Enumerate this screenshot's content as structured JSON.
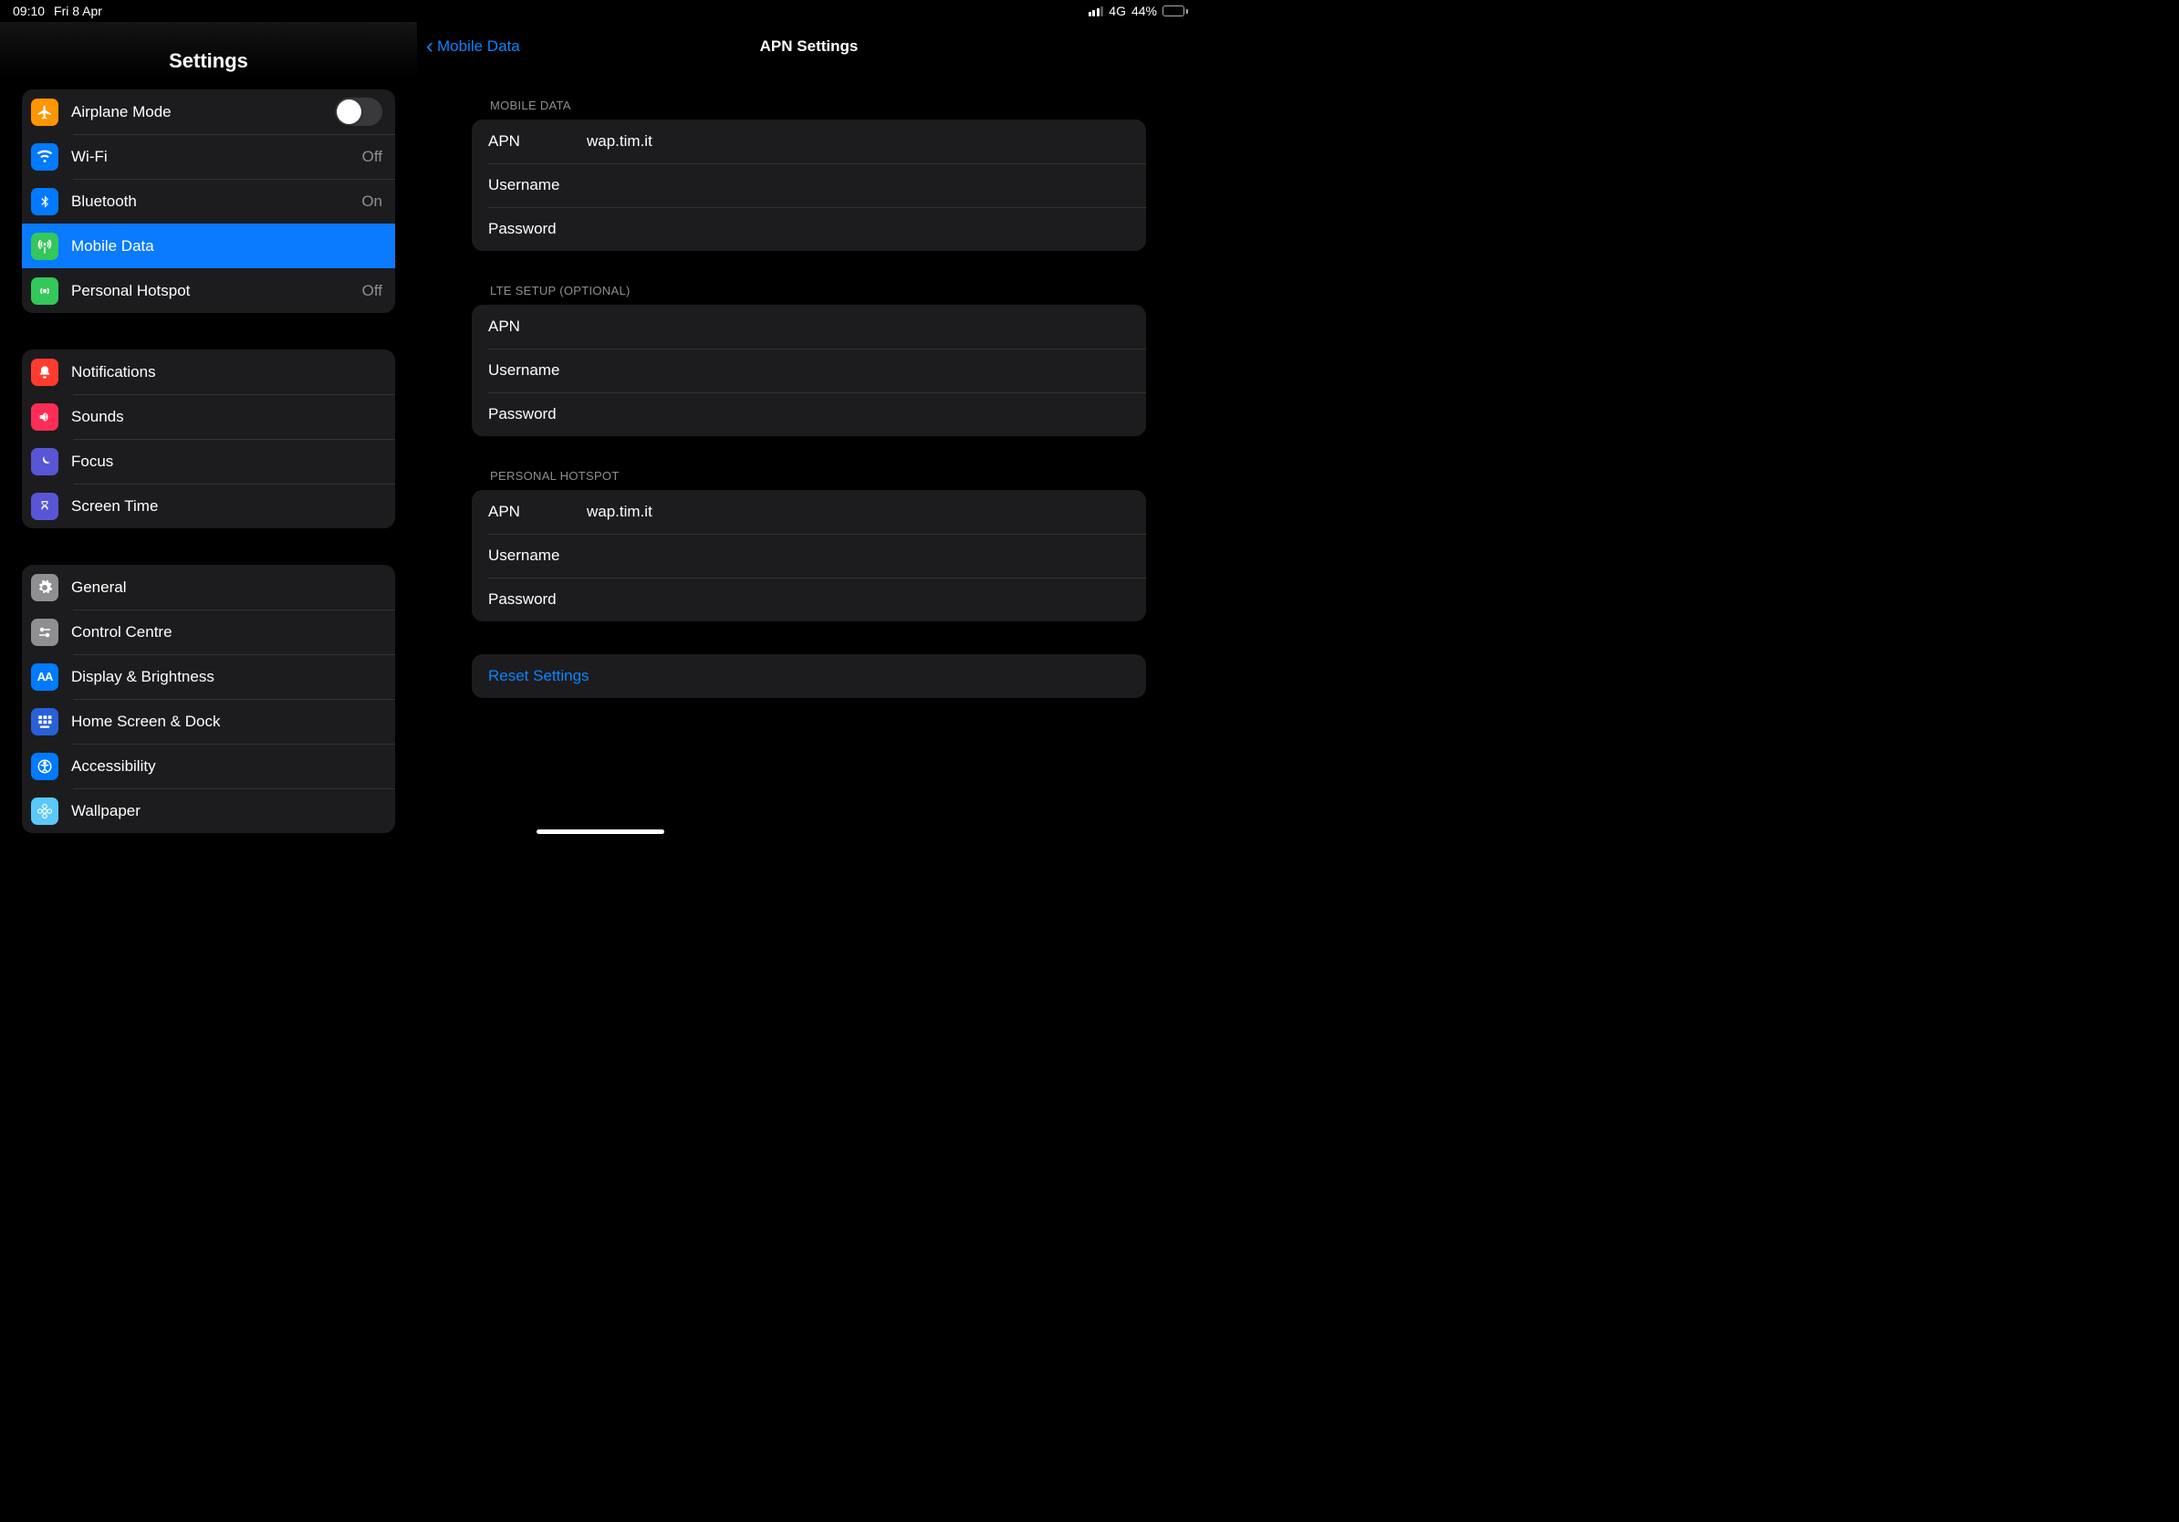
{
  "status": {
    "time": "09:10",
    "date": "Fri 8 Apr",
    "network": "4G",
    "battery_pct": "44%"
  },
  "sidebar": {
    "title": "Settings",
    "g1": {
      "airplane": "Airplane Mode",
      "wifi": "Wi-Fi",
      "wifi_val": "Off",
      "bluetooth": "Bluetooth",
      "bluetooth_val": "On",
      "mobile": "Mobile Data",
      "hotspot": "Personal Hotspot",
      "hotspot_val": "Off"
    },
    "g2": {
      "notifications": "Notifications",
      "sounds": "Sounds",
      "focus": "Focus",
      "screentime": "Screen Time"
    },
    "g3": {
      "general": "General",
      "control": "Control Centre",
      "display": "Display & Brightness",
      "home": "Home Screen & Dock",
      "access": "Accessibility",
      "wallpaper": "Wallpaper"
    }
  },
  "detail": {
    "back": "Mobile Data",
    "title": "APN Settings",
    "s1": {
      "header": "MOBILE DATA",
      "apn_label": "APN",
      "apn_val": "wap.tim.it",
      "user_label": "Username",
      "user_val": "",
      "pass_label": "Password",
      "pass_val": ""
    },
    "s2": {
      "header": "LTE SETUP (OPTIONAL)",
      "apn_label": "APN",
      "apn_val": "",
      "user_label": "Username",
      "user_val": "",
      "pass_label": "Password",
      "pass_val": ""
    },
    "s3": {
      "header": "PERSONAL HOTSPOT",
      "apn_label": "APN",
      "apn_val": "wap.tim.it",
      "user_label": "Username",
      "user_val": "",
      "pass_label": "Password",
      "pass_val": ""
    },
    "reset": "Reset Settings"
  }
}
